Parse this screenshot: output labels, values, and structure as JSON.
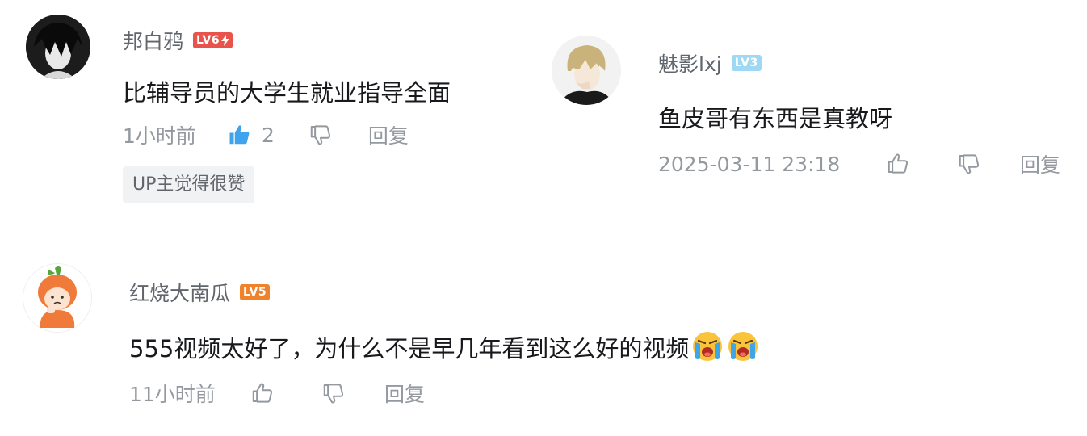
{
  "comments": [
    {
      "username": "邦白鸦",
      "level": "LV6",
      "content": "比辅导员的大学生就业指导全面",
      "time": "1小时前",
      "likes": "2",
      "reply": "回复",
      "badge": "UP主觉得很赞",
      "like_active": true,
      "colors": {
        "level": "#e8544c",
        "like_active": "#3fa3ee"
      }
    },
    {
      "username": "魅影lxj",
      "level": "LV3",
      "content": "鱼皮哥有东西是真教呀",
      "time": "2025-03-11 23:18",
      "reply": "回复",
      "colors": {
        "level": "#9fd8f2"
      }
    },
    {
      "username": "红烧大南瓜",
      "level": "LV5",
      "content": "555视频太好了，为什么不是早几年看到这么好的视频",
      "emojis": [
        "crying-emoji",
        "crying-emoji"
      ],
      "time": "11小时前",
      "reply": "回复",
      "colors": {
        "level": "#f0822b"
      }
    }
  ],
  "icons": [
    "thumb-up-icon",
    "thumb-down-icon",
    "crying-emoji"
  ]
}
